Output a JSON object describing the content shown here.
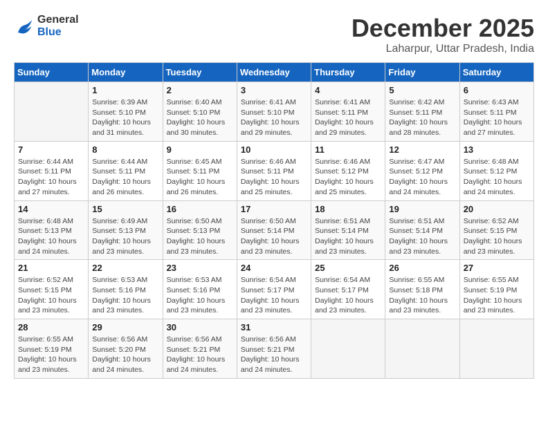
{
  "logo": {
    "line1": "General",
    "line2": "Blue"
  },
  "title": "December 2025",
  "location": "Laharpur, Uttar Pradesh, India",
  "weekdays": [
    "Sunday",
    "Monday",
    "Tuesday",
    "Wednesday",
    "Thursday",
    "Friday",
    "Saturday"
  ],
  "weeks": [
    [
      {
        "day": "",
        "sunrise": "",
        "sunset": "",
        "daylight": ""
      },
      {
        "day": "1",
        "sunrise": "Sunrise: 6:39 AM",
        "sunset": "Sunset: 5:10 PM",
        "daylight": "Daylight: 10 hours and 31 minutes."
      },
      {
        "day": "2",
        "sunrise": "Sunrise: 6:40 AM",
        "sunset": "Sunset: 5:10 PM",
        "daylight": "Daylight: 10 hours and 30 minutes."
      },
      {
        "day": "3",
        "sunrise": "Sunrise: 6:41 AM",
        "sunset": "Sunset: 5:10 PM",
        "daylight": "Daylight: 10 hours and 29 minutes."
      },
      {
        "day": "4",
        "sunrise": "Sunrise: 6:41 AM",
        "sunset": "Sunset: 5:11 PM",
        "daylight": "Daylight: 10 hours and 29 minutes."
      },
      {
        "day": "5",
        "sunrise": "Sunrise: 6:42 AM",
        "sunset": "Sunset: 5:11 PM",
        "daylight": "Daylight: 10 hours and 28 minutes."
      },
      {
        "day": "6",
        "sunrise": "Sunrise: 6:43 AM",
        "sunset": "Sunset: 5:11 PM",
        "daylight": "Daylight: 10 hours and 27 minutes."
      }
    ],
    [
      {
        "day": "7",
        "sunrise": "Sunrise: 6:44 AM",
        "sunset": "Sunset: 5:11 PM",
        "daylight": "Daylight: 10 hours and 27 minutes."
      },
      {
        "day": "8",
        "sunrise": "Sunrise: 6:44 AM",
        "sunset": "Sunset: 5:11 PM",
        "daylight": "Daylight: 10 hours and 26 minutes."
      },
      {
        "day": "9",
        "sunrise": "Sunrise: 6:45 AM",
        "sunset": "Sunset: 5:11 PM",
        "daylight": "Daylight: 10 hours and 26 minutes."
      },
      {
        "day": "10",
        "sunrise": "Sunrise: 6:46 AM",
        "sunset": "Sunset: 5:11 PM",
        "daylight": "Daylight: 10 hours and 25 minutes."
      },
      {
        "day": "11",
        "sunrise": "Sunrise: 6:46 AM",
        "sunset": "Sunset: 5:12 PM",
        "daylight": "Daylight: 10 hours and 25 minutes."
      },
      {
        "day": "12",
        "sunrise": "Sunrise: 6:47 AM",
        "sunset": "Sunset: 5:12 PM",
        "daylight": "Daylight: 10 hours and 24 minutes."
      },
      {
        "day": "13",
        "sunrise": "Sunrise: 6:48 AM",
        "sunset": "Sunset: 5:12 PM",
        "daylight": "Daylight: 10 hours and 24 minutes."
      }
    ],
    [
      {
        "day": "14",
        "sunrise": "Sunrise: 6:48 AM",
        "sunset": "Sunset: 5:13 PM",
        "daylight": "Daylight: 10 hours and 24 minutes."
      },
      {
        "day": "15",
        "sunrise": "Sunrise: 6:49 AM",
        "sunset": "Sunset: 5:13 PM",
        "daylight": "Daylight: 10 hours and 23 minutes."
      },
      {
        "day": "16",
        "sunrise": "Sunrise: 6:50 AM",
        "sunset": "Sunset: 5:13 PM",
        "daylight": "Daylight: 10 hours and 23 minutes."
      },
      {
        "day": "17",
        "sunrise": "Sunrise: 6:50 AM",
        "sunset": "Sunset: 5:14 PM",
        "daylight": "Daylight: 10 hours and 23 minutes."
      },
      {
        "day": "18",
        "sunrise": "Sunrise: 6:51 AM",
        "sunset": "Sunset: 5:14 PM",
        "daylight": "Daylight: 10 hours and 23 minutes."
      },
      {
        "day": "19",
        "sunrise": "Sunrise: 6:51 AM",
        "sunset": "Sunset: 5:14 PM",
        "daylight": "Daylight: 10 hours and 23 minutes."
      },
      {
        "day": "20",
        "sunrise": "Sunrise: 6:52 AM",
        "sunset": "Sunset: 5:15 PM",
        "daylight": "Daylight: 10 hours and 23 minutes."
      }
    ],
    [
      {
        "day": "21",
        "sunrise": "Sunrise: 6:52 AM",
        "sunset": "Sunset: 5:15 PM",
        "daylight": "Daylight: 10 hours and 23 minutes."
      },
      {
        "day": "22",
        "sunrise": "Sunrise: 6:53 AM",
        "sunset": "Sunset: 5:16 PM",
        "daylight": "Daylight: 10 hours and 23 minutes."
      },
      {
        "day": "23",
        "sunrise": "Sunrise: 6:53 AM",
        "sunset": "Sunset: 5:16 PM",
        "daylight": "Daylight: 10 hours and 23 minutes."
      },
      {
        "day": "24",
        "sunrise": "Sunrise: 6:54 AM",
        "sunset": "Sunset: 5:17 PM",
        "daylight": "Daylight: 10 hours and 23 minutes."
      },
      {
        "day": "25",
        "sunrise": "Sunrise: 6:54 AM",
        "sunset": "Sunset: 5:17 PM",
        "daylight": "Daylight: 10 hours and 23 minutes."
      },
      {
        "day": "26",
        "sunrise": "Sunrise: 6:55 AM",
        "sunset": "Sunset: 5:18 PM",
        "daylight": "Daylight: 10 hours and 23 minutes."
      },
      {
        "day": "27",
        "sunrise": "Sunrise: 6:55 AM",
        "sunset": "Sunset: 5:19 PM",
        "daylight": "Daylight: 10 hours and 23 minutes."
      }
    ],
    [
      {
        "day": "28",
        "sunrise": "Sunrise: 6:55 AM",
        "sunset": "Sunset: 5:19 PM",
        "daylight": "Daylight: 10 hours and 23 minutes."
      },
      {
        "day": "29",
        "sunrise": "Sunrise: 6:56 AM",
        "sunset": "Sunset: 5:20 PM",
        "daylight": "Daylight: 10 hours and 24 minutes."
      },
      {
        "day": "30",
        "sunrise": "Sunrise: 6:56 AM",
        "sunset": "Sunset: 5:21 PM",
        "daylight": "Daylight: 10 hours and 24 minutes."
      },
      {
        "day": "31",
        "sunrise": "Sunrise: 6:56 AM",
        "sunset": "Sunset: 5:21 PM",
        "daylight": "Daylight: 10 hours and 24 minutes."
      },
      {
        "day": "",
        "sunrise": "",
        "sunset": "",
        "daylight": ""
      },
      {
        "day": "",
        "sunrise": "",
        "sunset": "",
        "daylight": ""
      },
      {
        "day": "",
        "sunrise": "",
        "sunset": "",
        "daylight": ""
      }
    ]
  ]
}
